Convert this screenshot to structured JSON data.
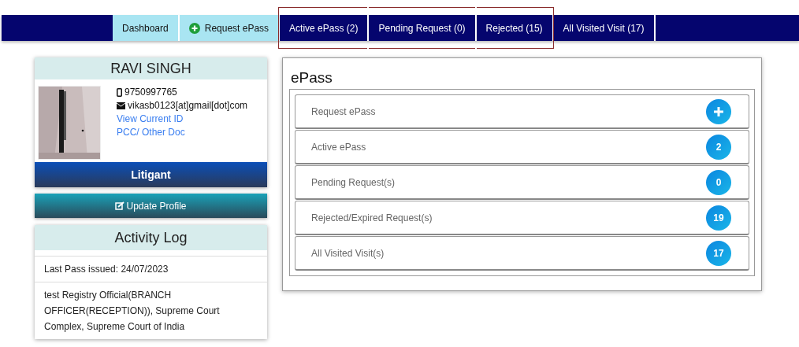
{
  "nav": {
    "tabs": [
      {
        "label": "Dashboard",
        "kind": "light",
        "highlighted": false
      },
      {
        "label": "Request ePass",
        "kind": "light-add",
        "highlighted": false
      },
      {
        "label": "Active ePass (2)",
        "kind": "dark",
        "highlighted": true
      },
      {
        "label": "Pending Request (0)",
        "kind": "dark",
        "highlighted": true
      },
      {
        "label": "Rejected (15)",
        "kind": "dark",
        "highlighted": true
      },
      {
        "label": "All Visited Visit (17)",
        "kind": "dark",
        "highlighted": false
      }
    ]
  },
  "profile": {
    "name": "RAVI SINGH",
    "phone": "9750997765",
    "email": "vikasb0123[at]gmail[dot]com",
    "links": [
      "View Current ID",
      "PCC/ Other Doc"
    ],
    "role": "Litigant",
    "update_button": "Update Profile"
  },
  "activity_log": {
    "title": "Activity Log",
    "entries": [
      "Last Pass issued: 24/07/2023",
      "test Registry Official(BRANCH OFFICER(RECEPTION)), Supreme Court Complex, Supreme Court of India"
    ]
  },
  "epass": {
    "title": "ePass",
    "items": [
      {
        "label": "Request ePass",
        "kind": "add"
      },
      {
        "label": "Active ePass",
        "kind": "count",
        "count": "2"
      },
      {
        "label": "Pending Request(s)",
        "kind": "count",
        "count": "0"
      },
      {
        "label": "Rejected/Expired Request(s)",
        "kind": "count",
        "count": "19"
      },
      {
        "label": "All Visited Visit(s)",
        "kind": "count",
        "count": "17"
      }
    ]
  }
}
